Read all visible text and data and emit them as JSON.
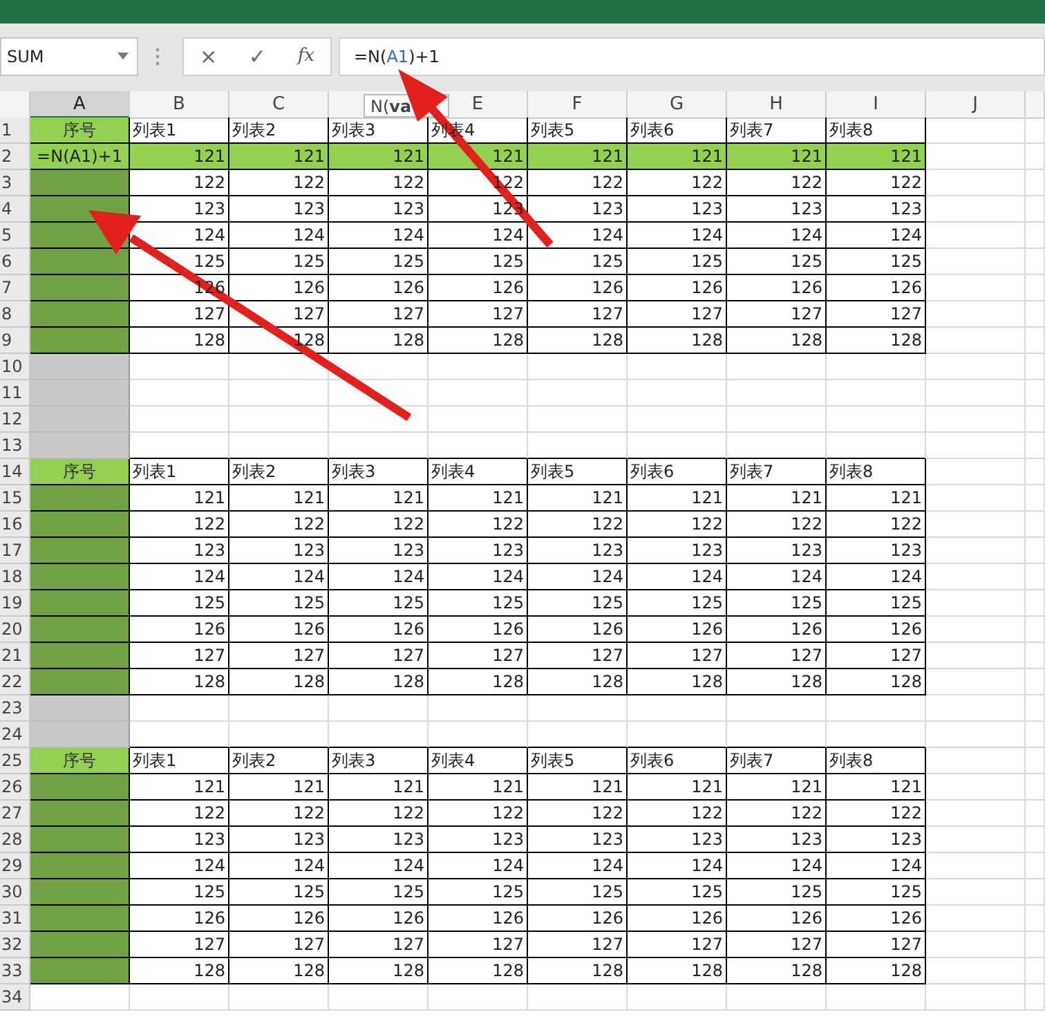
{
  "formula_bar": {
    "name_box": "SUM",
    "buttons": [
      "×",
      "✓"
    ],
    "function_label": "fx",
    "formula": [
      {
        "kind": "plain",
        "text": "=N("
      },
      {
        "kind": "ref",
        "text": "A1"
      },
      {
        "kind": "plain",
        "text": ")+1"
      }
    ],
    "tooltip": "N(**va**"
  },
  "columns": [
    {
      "label": "A",
      "selected": true
    },
    {
      "label": "B",
      "selected": false
    },
    {
      "label": "C",
      "selected": false
    },
    {
      "selected": false
    },
    {
      "label": "E",
      "selected": false
    },
    {
      "label": "F",
      "selected": false
    },
    {
      "label": "G",
      "selected": false
    },
    {
      "label": "H",
      "selected": false
    },
    {
      "label": "I",
      "selected": false
    },
    {
      "label": "J",
      "selected": false
    }
  ],
  "rows": [
    {
      "number": "1",
      "kind": "header",
      "label": "序号",
      "cells": [
        "列表1",
        "列表2",
        "列表3",
        "列表4",
        "列表5",
        "列表6",
        "列表7",
        "列表8"
      ]
    },
    {
      "number": "2",
      "kind": "highlight",
      "label": "=N(A1)+1",
      "cells": [
        "121",
        "121",
        "121",
        "121",
        "121",
        "121",
        "121",
        "121"
      ]
    },
    {
      "number": "3",
      "kind": "data",
      "cells": [
        "122",
        "122",
        "122",
        "122",
        "122",
        "122",
        "122",
        "122"
      ]
    },
    {
      "number": "4",
      "kind": "data",
      "cells": [
        "123",
        "123",
        "123",
        "123",
        "123",
        "123",
        "123",
        "123"
      ]
    },
    {
      "number": "5",
      "kind": "data",
      "cells": [
        "124",
        "124",
        "124",
        "124",
        "124",
        "124",
        "124",
        "124"
      ]
    },
    {
      "number": "6",
      "kind": "data",
      "cells": [
        "125",
        "125",
        "125",
        "125",
        "125",
        "125",
        "125",
        "125"
      ]
    },
    {
      "number": "7",
      "kind": "data",
      "cells": [
        "126",
        "126",
        "126",
        "126",
        "126",
        "126",
        "126",
        "126"
      ]
    },
    {
      "number": "8",
      "kind": "data",
      "cells": [
        "127",
        "127",
        "127",
        "127",
        "127",
        "127",
        "127",
        "127"
      ]
    },
    {
      "number": "9",
      "kind": "data",
      "cells": [
        "128",
        "128",
        "128",
        "128",
        "128",
        "128",
        "128",
        "128"
      ]
    },
    {
      "number": "10",
      "kind": "gap"
    },
    {
      "number": "11",
      "kind": "gap"
    },
    {
      "number": "12",
      "kind": "gap"
    },
    {
      "number": "13",
      "kind": "gap"
    },
    {
      "number": "14",
      "kind": "header",
      "label": "序号",
      "cells": [
        "列表1",
        "列表2",
        "列表3",
        "列表4",
        "列表5",
        "列表6",
        "列表7",
        "列表8"
      ]
    },
    {
      "number": "15",
      "kind": "data",
      "cells": [
        "121",
        "121",
        "121",
        "121",
        "121",
        "121",
        "121",
        "121"
      ]
    },
    {
      "number": "16",
      "kind": "data",
      "cells": [
        "122",
        "122",
        "122",
        "122",
        "122",
        "122",
        "122",
        "122"
      ]
    },
    {
      "number": "17",
      "kind": "data",
      "cells": [
        "123",
        "123",
        "123",
        "123",
        "123",
        "123",
        "123",
        "123"
      ]
    },
    {
      "number": "18",
      "kind": "data",
      "cells": [
        "124",
        "124",
        "124",
        "124",
        "124",
        "124",
        "124",
        "124"
      ]
    },
    {
      "number": "19",
      "kind": "data",
      "cells": [
        "125",
        "125",
        "125",
        "125",
        "125",
        "125",
        "125",
        "125"
      ]
    },
    {
      "number": "20",
      "kind": "data",
      "cells": [
        "126",
        "126",
        "126",
        "126",
        "126",
        "126",
        "126",
        "126"
      ]
    },
    {
      "number": "21",
      "kind": "data",
      "cells": [
        "127",
        "127",
        "127",
        "127",
        "127",
        "127",
        "127",
        "127"
      ]
    },
    {
      "number": "22",
      "kind": "data",
      "cells": [
        "128",
        "128",
        "128",
        "128",
        "128",
        "128",
        "128",
        "128"
      ]
    },
    {
      "number": "23",
      "kind": "gap"
    },
    {
      "number": "24",
      "kind": "gap"
    },
    {
      "number": "25",
      "kind": "header",
      "label": "序号",
      "cells": [
        "列表1",
        "列表2",
        "列表3",
        "列表4",
        "列表5",
        "列表6",
        "列表7",
        "列表8"
      ]
    },
    {
      "number": "26",
      "kind": "data",
      "cells": [
        "121",
        "121",
        "121",
        "121",
        "121",
        "121",
        "121",
        "121"
      ]
    },
    {
      "number": "27",
      "kind": "data",
      "cells": [
        "122",
        "122",
        "122",
        "122",
        "122",
        "122",
        "122",
        "122"
      ]
    },
    {
      "number": "28",
      "kind": "data",
      "cells": [
        "123",
        "123",
        "123",
        "123",
        "123",
        "123",
        "123",
        "123"
      ]
    },
    {
      "number": "29",
      "kind": "data",
      "cells": [
        "124",
        "124",
        "124",
        "124",
        "124",
        "124",
        "124",
        "124"
      ]
    },
    {
      "number": "30",
      "kind": "data",
      "cells": [
        "125",
        "125",
        "125",
        "125",
        "125",
        "125",
        "125",
        "125"
      ]
    },
    {
      "number": "31",
      "kind": "data",
      "cells": [
        "126",
        "126",
        "126",
        "126",
        "126",
        "126",
        "126",
        "126"
      ]
    },
    {
      "number": "32",
      "kind": "data",
      "cells": [
        "127",
        "127",
        "127",
        "127",
        "127",
        "127",
        "127",
        "127"
      ]
    },
    {
      "number": "33",
      "kind": "data",
      "cells": [
        "128",
        "128",
        "128",
        "128",
        "128",
        "128",
        "128",
        "128"
      ]
    },
    {
      "number": "34",
      "kind": "empty"
    }
  ]
}
